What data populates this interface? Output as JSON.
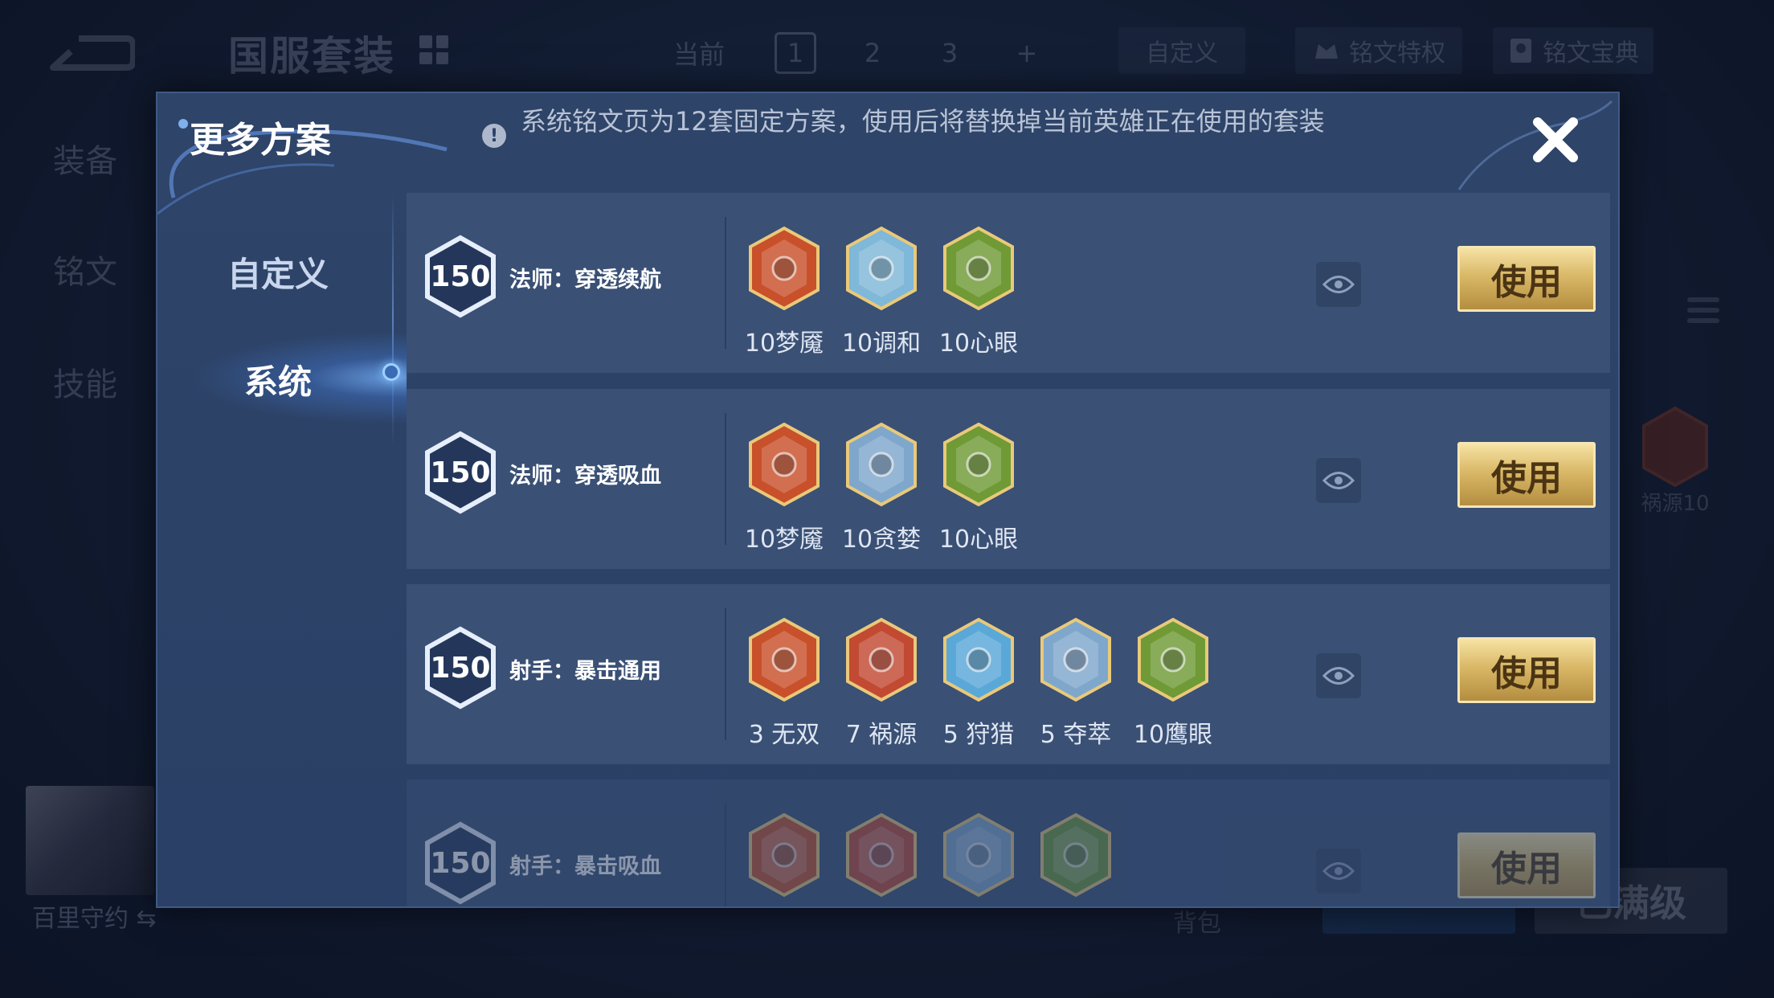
{
  "background": {
    "title": "国服套装",
    "page_tabs": {
      "current_label": "当前",
      "pages": [
        "1",
        "2",
        "3"
      ],
      "add": "+"
    },
    "custom_btn": "自定义",
    "privilege_btn": "铭文特权",
    "codex_btn": "铭文宝典",
    "side_tabs": [
      "装备",
      "铭文",
      "技能"
    ],
    "right_rune_label": "祸源10",
    "hero_name": "百里守约",
    "bag_label": "背包",
    "max_level_btn": "已满级"
  },
  "modal": {
    "title": "更多方案",
    "notice": "系统铭文页为12套固定方案，使用后将替换掉当前英雄正在使用的套装",
    "menu": [
      "自定义",
      "系统"
    ],
    "selected_menu": "系统"
  },
  "plans": [
    {
      "level": "150",
      "name": "法师：穿透续航",
      "runes": [
        {
          "label": "10梦魇",
          "icon": "nightmare-rune-icon",
          "color": "#c8502a"
        },
        {
          "label": "10调和",
          "icon": "harmony-rune-icon",
          "color": "#7fb8d8"
        },
        {
          "label": "10心眼",
          "icon": "mind-eye-rune-icon",
          "color": "#6f9a36"
        }
      ],
      "use_label": "使用"
    },
    {
      "level": "150",
      "name": "法师：穿透吸血",
      "runes": [
        {
          "label": "10梦魇",
          "icon": "nightmare-rune-icon",
          "color": "#c8502a"
        },
        {
          "label": "10贪婪",
          "icon": "greed-rune-icon",
          "color": "#7fa7cc"
        },
        {
          "label": "10心眼",
          "icon": "mind-eye-rune-icon",
          "color": "#6f9a36"
        }
      ],
      "use_label": "使用"
    },
    {
      "level": "150",
      "name": "射手：暴击通用",
      "runes": [
        {
          "label": "3 无双",
          "icon": "unrivaled-rune-icon",
          "color": "#c8502a"
        },
        {
          "label": "7 祸源",
          "icon": "calamity-rune-icon",
          "color": "#c24a32"
        },
        {
          "label": "5 狩猎",
          "icon": "hunting-rune-icon",
          "color": "#5aa8d8"
        },
        {
          "label": "5 夺萃",
          "icon": "plunder-rune-icon",
          "color": "#7fa7cc"
        },
        {
          "label": "10鹰眼",
          "icon": "hawk-eye-rune-icon",
          "color": "#6f9a36"
        }
      ],
      "use_label": "使用"
    },
    {
      "level": "150",
      "name": "射手：暴击吸血",
      "runes": [
        {
          "label": "",
          "icon": "unrivaled-rune-icon",
          "color": "#c8502a"
        },
        {
          "label": "",
          "icon": "calamity-rune-icon",
          "color": "#c24a32"
        },
        {
          "label": "",
          "icon": "plunder-rune-icon",
          "color": "#7fa7cc"
        },
        {
          "label": "",
          "icon": "hawk-eye-rune-icon",
          "color": "#6f9a36"
        }
      ],
      "use_label": "使用"
    }
  ],
  "colors": {
    "gold_button": "#d9b867",
    "panel": "#2b4066",
    "row": "#3a5075"
  }
}
